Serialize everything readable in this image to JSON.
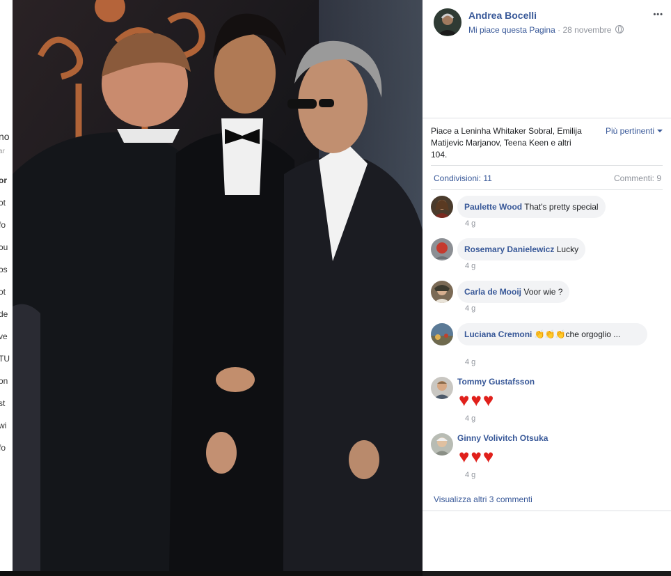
{
  "background_page": {
    "fragments": [
      "no",
      "ar",
      "or",
      "ot",
      "fo",
      "ou",
      "os",
      "ot",
      "de",
      "ve",
      "TU",
      "on",
      "st",
      "wi",
      "fo"
    ]
  },
  "post": {
    "page_name": "Andrea Bocelli",
    "like_page": "Mi piace questa Pagina",
    "separator": "·",
    "date": "28 novembre",
    "more": "•••"
  },
  "reactions": {
    "likes_text": "Piace a Leninha Whitaker Sobral, Emilija Matijevic Marjanov, Teena Keen e altri 104.",
    "sort_label": "Più pertinenti",
    "shares": "Condivisioni: 11",
    "comments": "Commenti: 9"
  },
  "comments": [
    {
      "author": "Paulette Wood",
      "text": "That's pretty special",
      "time": "4 g"
    },
    {
      "author": "Rosemary Danielewicz",
      "text": "Lucky",
      "time": "4 g"
    },
    {
      "author": "Carla de Mooij",
      "text": "Voor wie ?",
      "time": "4 g"
    },
    {
      "author": "Luciana Cremoni",
      "text": "👏👏👏che orgoglio ...",
      "time": "4 g"
    },
    {
      "author": "Tommy Gustafsson",
      "text": "♥♥♥",
      "time": "4 g"
    },
    {
      "author": "Ginny Volivitch Otsuka",
      "text": "♥♥♥",
      "time": "4 g"
    }
  ],
  "view_more": "Visualizza altri 3 commenti",
  "colors": {
    "link": "#385898",
    "muted": "#90949c",
    "bubble": "#f2f3f5",
    "heart": "#e0201b"
  }
}
